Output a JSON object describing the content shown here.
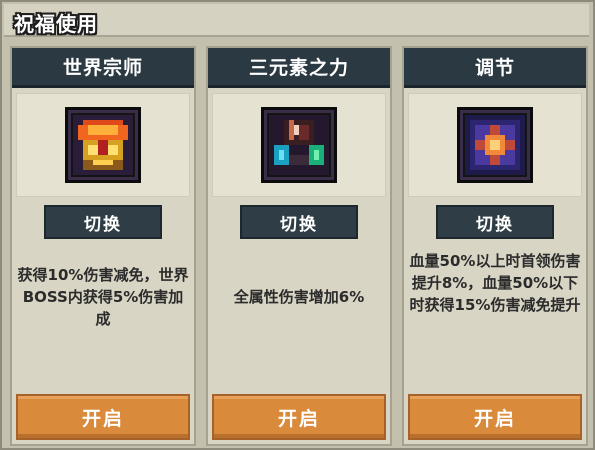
{
  "window": {
    "title": "祝福使用"
  },
  "cards": [
    {
      "name": "世界宗师",
      "icon": "golden-armor-icon",
      "switch_label": "切换",
      "description": "获得10%伤害减免，世界BOSS内获得5%伤害加成",
      "open_label": "开启"
    },
    {
      "name": "三元素之力",
      "icon": "elemental-potions-icon",
      "switch_label": "切换",
      "description": "全属性伤害增加6%",
      "open_label": "开启"
    },
    {
      "name": "调节",
      "icon": "balance-rune-icon",
      "switch_label": "切换",
      "description": "血量50%以上时首领伤害提升8%，血量50%以下时获得15%伤害减免提升",
      "open_label": "开启"
    }
  ],
  "colors": {
    "card_header": "#2b3a42",
    "open_button": "#d98a3a",
    "switch_button": "#2f3e46"
  }
}
